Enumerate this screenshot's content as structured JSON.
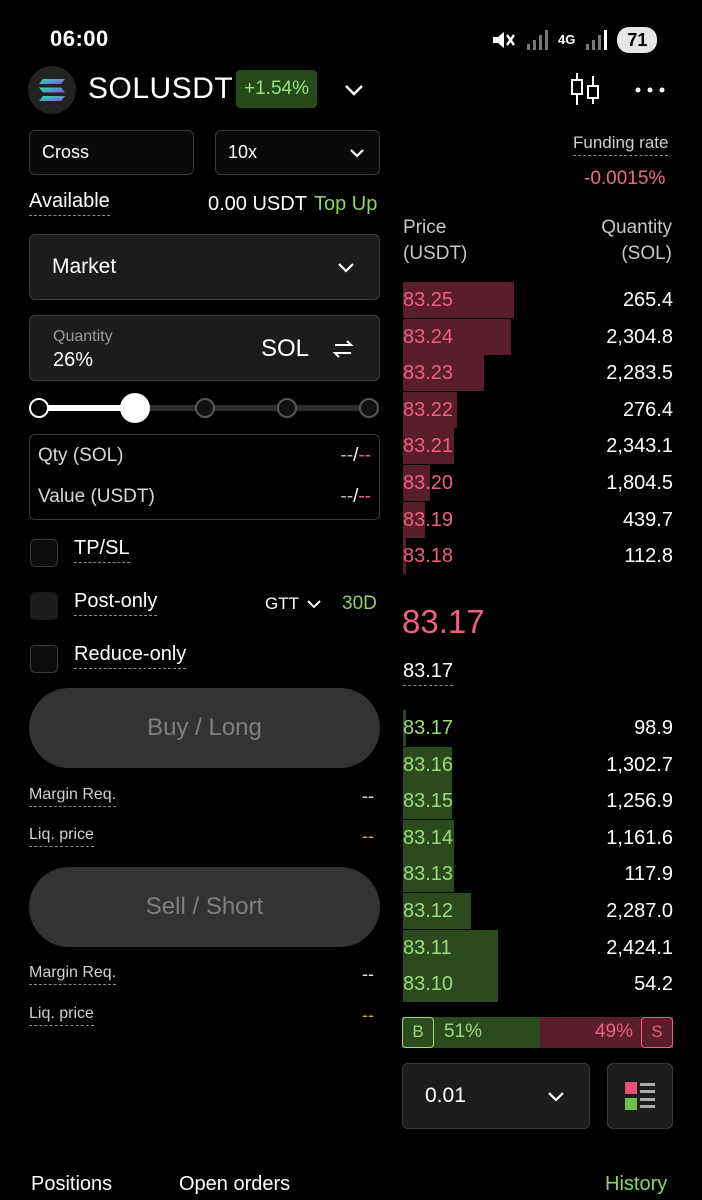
{
  "status_bar": {
    "time": "06:00",
    "network": "4G",
    "battery": "71"
  },
  "header": {
    "pair": "SOLUSDT",
    "change": "+1.54%",
    "colors": {
      "up": "#9be07a",
      "down": "#f06080"
    }
  },
  "form": {
    "margin_mode": "Cross",
    "leverage": "10x",
    "available_label": "Available",
    "available_value": "0.00 USDT",
    "top_up": "Top Up",
    "order_type": "Market",
    "quantity_label": "Quantity",
    "quantity_value": "26%",
    "quantity_unit": "SOL",
    "slider_percent": 26,
    "qty_label": "Qty (SOL)",
    "value_label": "Value (USDT)",
    "dash_a": "--",
    "dash_sep": "/",
    "dash_b": "--",
    "tpsl": "TP/SL",
    "post_only": "Post-only",
    "gtt": "GTT",
    "gtt_days": "30D",
    "reduce_only": "Reduce-only",
    "buy_label": "Buy / Long",
    "sell_label": "Sell / Short",
    "margin_req_label": "Margin Req.",
    "liq_price_label": "Liq. price",
    "buy_margin_req": "--",
    "buy_liq_price": "--",
    "sell_margin_req": "--",
    "sell_liq_price": "--"
  },
  "orderbook": {
    "funding_label": "Funding rate",
    "funding_value": "-0.0015%",
    "price_header": [
      "Price",
      "(USDT)"
    ],
    "qty_header": [
      "Quantity",
      "(SOL)"
    ],
    "asks": [
      {
        "price": "83.25",
        "qty": "265.4",
        "depth": 0.41
      },
      {
        "price": "83.24",
        "qty": "2,304.8",
        "depth": 0.4
      },
      {
        "price": "83.23",
        "qty": "2,283.5",
        "depth": 0.3
      },
      {
        "price": "83.22",
        "qty": "276.4",
        "depth": 0.2
      },
      {
        "price": "83.21",
        "qty": "2,343.1",
        "depth": 0.19
      },
      {
        "price": "83.20",
        "qty": "1,804.5",
        "depth": 0.1
      },
      {
        "price": "83.19",
        "qty": "439.7",
        "depth": 0.08
      },
      {
        "price": "83.18",
        "qty": "112.8",
        "depth": 0.01
      }
    ],
    "last_price": "83.17",
    "mark_price": "83.17",
    "bids": [
      {
        "price": "83.17",
        "qty": "98.9",
        "depth": 0.01
      },
      {
        "price": "83.16",
        "qty": "1,302.7",
        "depth": 0.18
      },
      {
        "price": "83.15",
        "qty": "1,256.9",
        "depth": 0.18
      },
      {
        "price": "83.14",
        "qty": "1,161.6",
        "depth": 0.19
      },
      {
        "price": "83.13",
        "qty": "117.9",
        "depth": 0.19
      },
      {
        "price": "83.12",
        "qty": "2,287.0",
        "depth": 0.25
      },
      {
        "price": "83.11",
        "qty": "2,424.1",
        "depth": 0.35
      },
      {
        "price": "83.10",
        "qty": "54.2",
        "depth": 0.35
      }
    ],
    "buy_tag": "B",
    "buy_ratio": "51%",
    "sell_ratio": "49%",
    "sell_tag": "S",
    "tick_size": "0.01"
  },
  "tabs": {
    "positions": "Positions",
    "open_orders": "Open orders",
    "history": "History"
  }
}
